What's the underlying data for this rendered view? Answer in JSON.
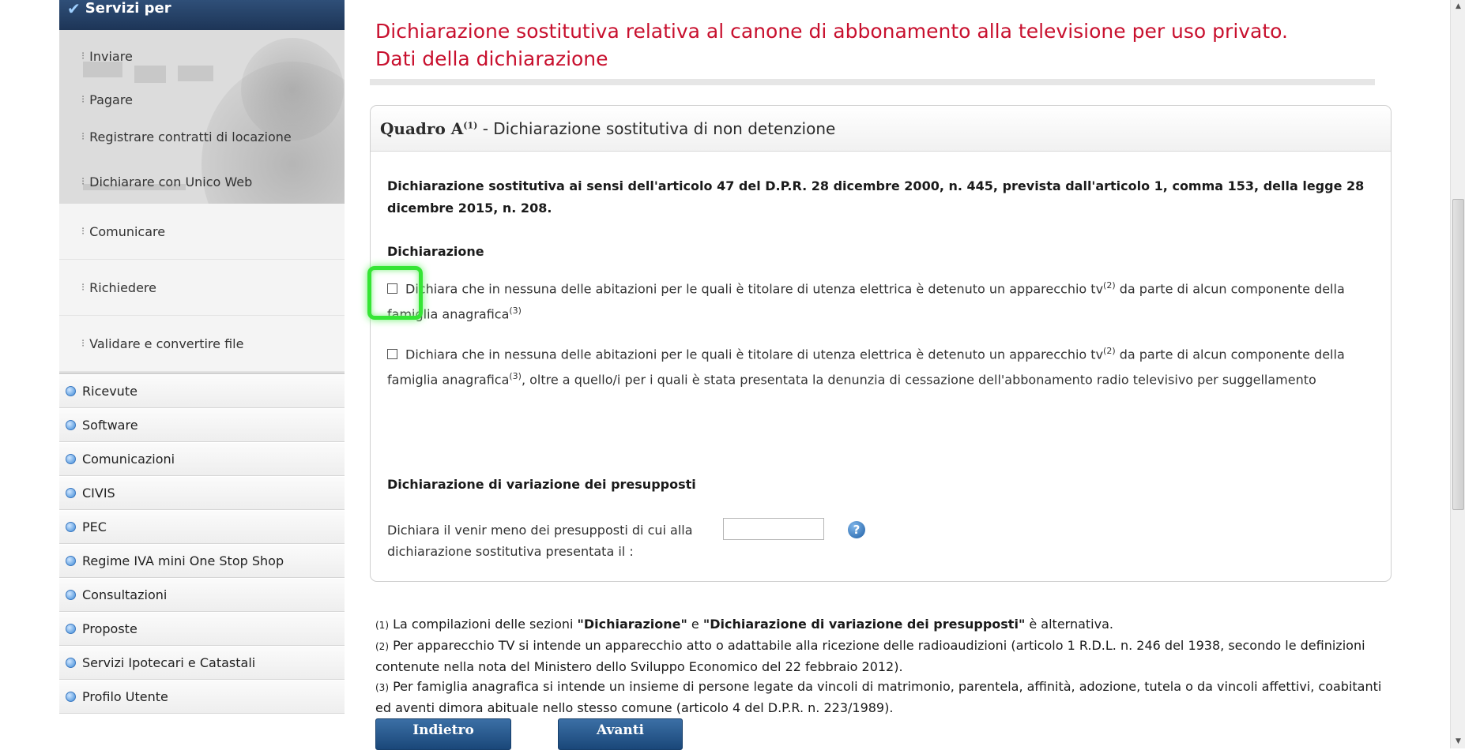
{
  "sidebar": {
    "services_title": "Servizi per",
    "services": [
      {
        "label": "Inviare"
      },
      {
        "label": "Pagare"
      },
      {
        "label": "Registrare contratti di locazione"
      },
      {
        "label": "Dichiarare con Unico Web"
      },
      {
        "label": "Comunicare"
      },
      {
        "label": "Richiedere"
      },
      {
        "label": "Validare e convertire file"
      }
    ],
    "nav": [
      {
        "label": "Ricevute"
      },
      {
        "label": "Software"
      },
      {
        "label": "Comunicazioni"
      },
      {
        "label": "CIVIS"
      },
      {
        "label": "PEC"
      },
      {
        "label": "Regime IVA mini One Stop Shop"
      },
      {
        "label": "Consultazioni"
      },
      {
        "label": "Proposte"
      },
      {
        "label": "Servizi Ipotecari e Catastali"
      },
      {
        "label": "Profilo Utente"
      }
    ]
  },
  "main": {
    "title_line1": "Dichiarazione sostitutiva relativa al canone di abbonamento alla televisione per uso privato.",
    "title_line2": "Dati della dichiarazione",
    "panel": {
      "heading_prefix": "Quadro A",
      "heading_sup": "(1)",
      "heading_rest": " - Dichiarazione sostitutiva di non detenzione",
      "intro": "Dichiarazione sostitutiva ai sensi dell'articolo 47 del D.P.R. 28 dicembre 2000, n. 445, prevista dall'articolo 1, comma 153, della legge 28 dicembre 2015, n. 208.",
      "section1_title": "Dichiarazione",
      "option1": {
        "part1": "Dichiara che in nessuna delle abitazioni per le quali è titolare di utenza elettrica è detenuto un apparecchio tv",
        "sup1": "(2)",
        "part2": " da parte di alcun componente della famiglia anagrafica",
        "sup2": "(3)"
      },
      "option2": {
        "part1": "Dichiara che in nessuna delle abitazioni per le quali è titolare di utenza elettrica è detenuto un apparecchio tv",
        "sup1": "(2)",
        "part2": " da parte di alcun componente della famiglia anagrafica",
        "sup2": "(3)",
        "part3": ", oltre a quello/i per i quali è stata presentata la denunzia di cessazione dell'abbonamento radio televisivo per suggellamento"
      },
      "section2_title": "Dichiarazione di variazione dei presupposti",
      "variation_label": "Dichiara il venir meno dei presupposti di cui alla dichiarazione sostitutiva presentata il :",
      "variation_date_value": "",
      "help_glyph": "?"
    },
    "footnotes": [
      {
        "num": "(1)",
        "pre": " La compilazioni delle sezioni ",
        "b1": "\"Dichiarazione\"",
        "mid": " e ",
        "b2": "\"Dichiarazione di variazione dei presupposti\"",
        "post": " è alternativa."
      },
      {
        "num": "(2)",
        "text": " Per apparecchio TV si intende un apparecchio atto o adattabile alla ricezione delle radioaudizioni (articolo 1 R.D.L. n. 246 del 1938, secondo le definizioni contenute nella nota del Ministero dello Sviluppo Economico del 22 febbraio 2012)."
      },
      {
        "num": "(3)",
        "text": " Per famiglia anagrafica si intende un insieme di persone legate da vincoli di matrimonio, parentela, affinità, adozione, tutela o da vincoli affettivi, coabitanti ed aventi dimora abituale nello stesso comune (articolo 4 del D.P.R. n. 223/1989)."
      }
    ],
    "buttons": {
      "back": "Indietro",
      "next": "Avanti"
    }
  },
  "colors": {
    "title_red": "#c8102e",
    "button_blue": "#1f4e80",
    "highlight_green": "#35e535",
    "sidebar_header": "#1d3557"
  },
  "icons": {
    "check": "checkmark-icon",
    "bullet": "bullet-icon",
    "nav_dot": "blue-dot-icon",
    "help": "question-mark-icon"
  }
}
